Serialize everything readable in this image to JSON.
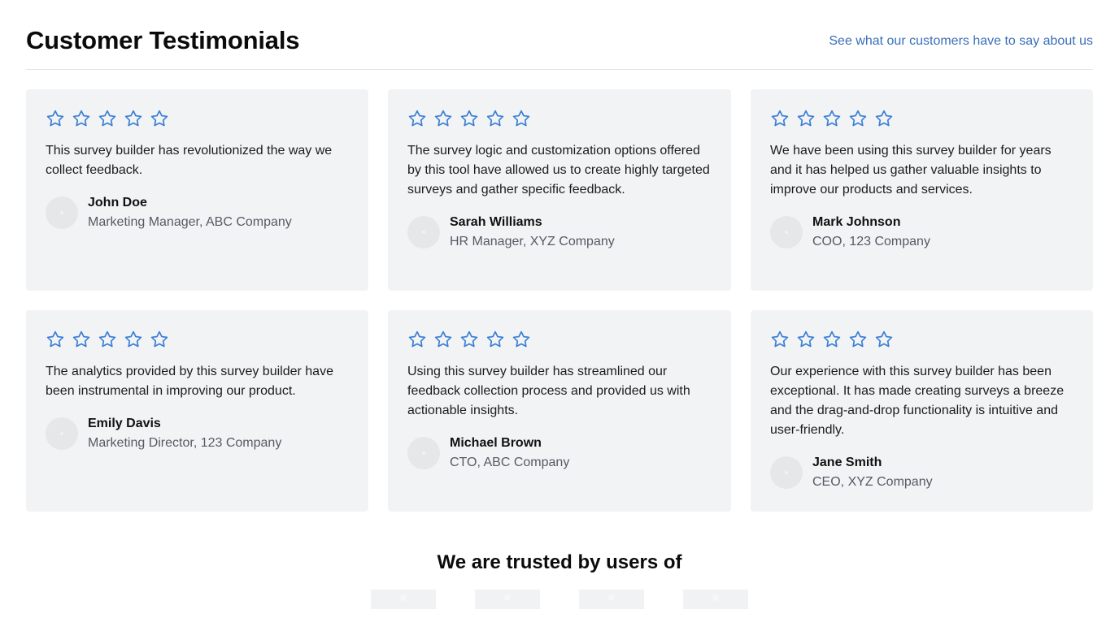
{
  "header": {
    "title": "Customer Testimonials",
    "link_label": "See what our customers have to say about us"
  },
  "colors": {
    "accent": "#3a6fb8",
    "star": "#3b7fd4",
    "card_bg": "#f2f3f5"
  },
  "testimonials": [
    {
      "rating_stars": 5,
      "quote": "This survey builder has revolutionized the way we collect feedback.",
      "name": "John Doe",
      "role": "Marketing Manager, ABC Company"
    },
    {
      "rating_stars": 5,
      "quote": "The survey logic and customization options offered by this tool have allowed us to create highly targeted surveys and gather specific feedback.",
      "name": "Sarah Williams",
      "role": "HR Manager, XYZ Company"
    },
    {
      "rating_stars": 5,
      "quote": "We have been using this survey builder for years and it has helped us gather valuable insights to improve our products and services.",
      "name": "Mark Johnson",
      "role": "COO, 123 Company"
    },
    {
      "rating_stars": 5,
      "quote": "The analytics provided by this survey builder have been instrumental in improving our product.",
      "name": "Emily Davis",
      "role": "Marketing Director, 123 Company"
    },
    {
      "rating_stars": 5,
      "quote": "Using this survey builder has streamlined our feedback collection process and provided us with actionable insights.",
      "name": "Michael Brown",
      "role": "CTO, ABC Company"
    },
    {
      "rating_stars": 5,
      "quote": "Our experience with this survey builder has been exceptional. It has made creating surveys a breeze and the drag-and-drop functionality is intuitive and user-friendly.",
      "name": "Jane Smith",
      "role": "CEO, XYZ Company"
    }
  ],
  "trusted": {
    "title": "We are trusted by users of",
    "logo_count": 4
  }
}
